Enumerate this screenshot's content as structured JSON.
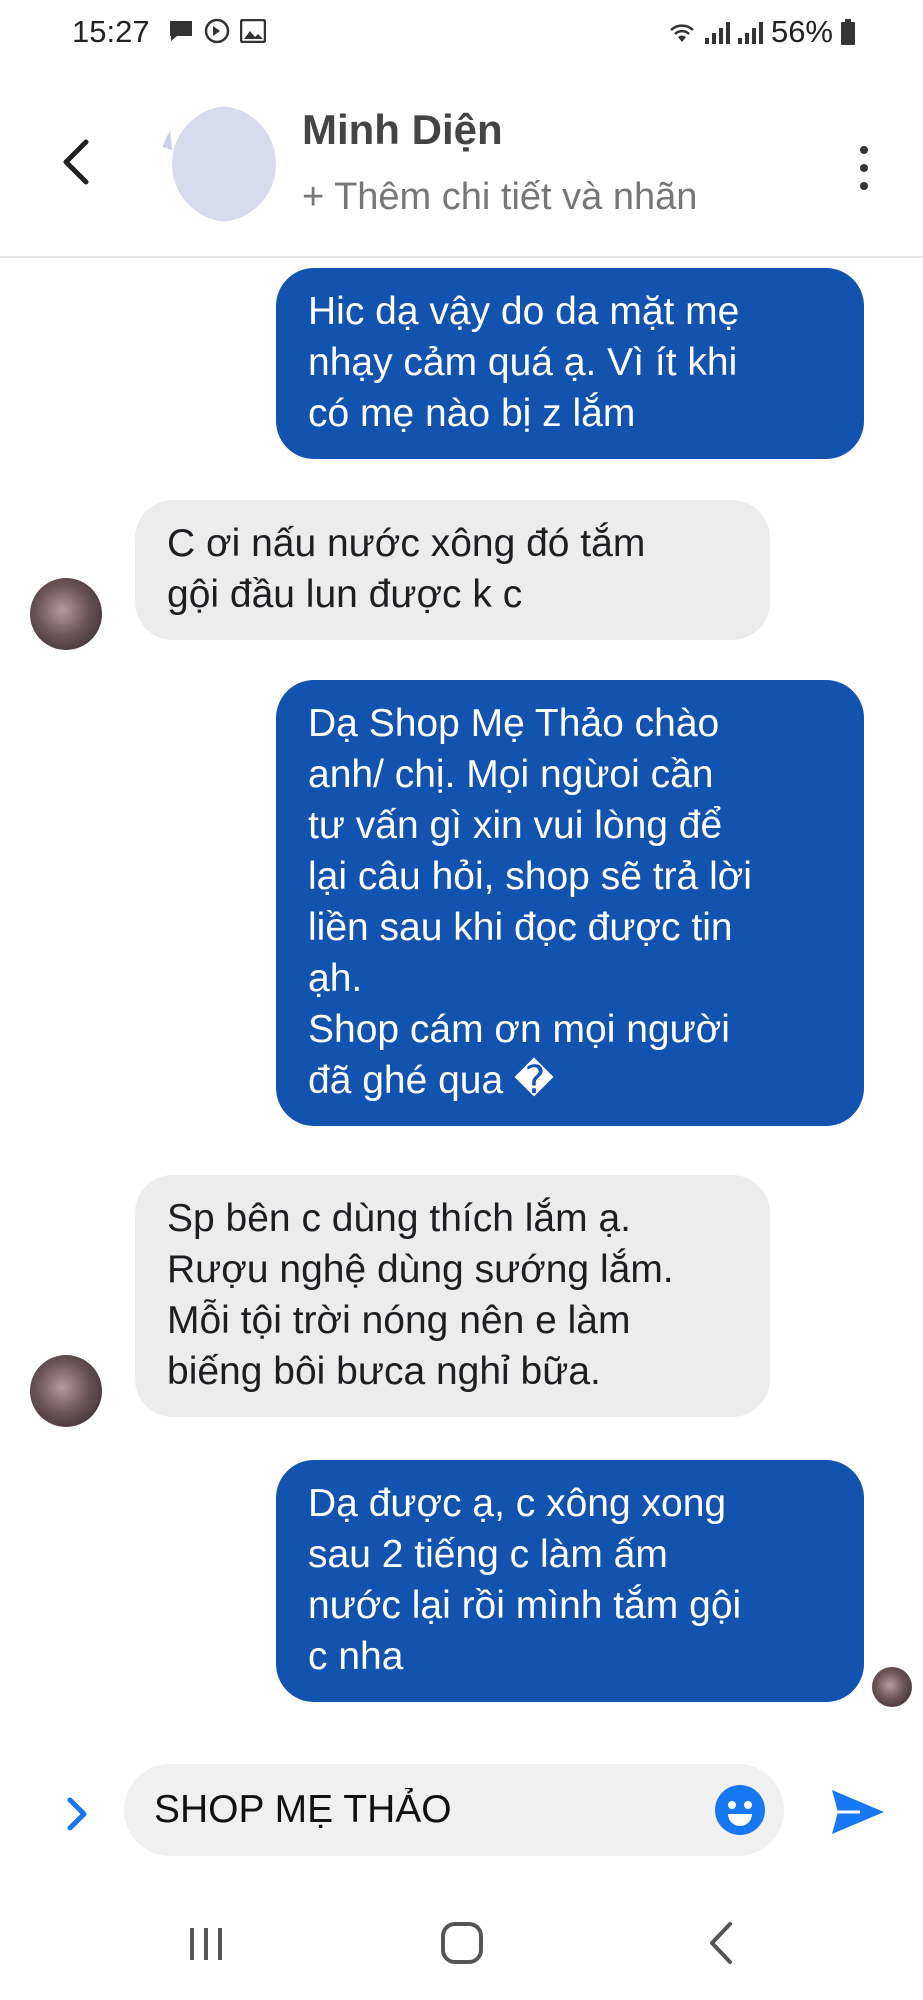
{
  "status_bar": {
    "time": "15:27",
    "battery": "56%"
  },
  "header": {
    "contact_name": "Minh Diện",
    "subtitle": "+ Thêm chi tiết và nhãn"
  },
  "messages": [
    {
      "direction": "outgoing",
      "text": "Hic dạ vậy do da mặt mẹ\nnhạy cảm quá ạ. Vì ít khi\ncó mẹ nào bị z lắm"
    },
    {
      "direction": "incoming",
      "text": "C ơi nấu nước xông đó tắm\ngội đầu lun được k c"
    },
    {
      "direction": "outgoing",
      "text": "Dạ Shop Mẹ Thảo chào\nanh/ chị. Mọi ngừoi cần\ntư vấn gì xin vui lòng để\nlại câu hỏi, shop sẽ trả lời\nliền sau khi đọc được tin\nạh.\nShop cám ơn mọi người\nđã ghé qua �"
    },
    {
      "direction": "incoming",
      "text": "Sp bên c dùng thích lắm ạ.\nRượu nghệ dùng sướng lắm.\nMỗi tội trời nóng nên e làm\nbiếng bôi bưca nghỉ bữa."
    },
    {
      "direction": "outgoing",
      "text": "Dạ được ạ, c xông xong\nsau 2 tiếng c làm ấm\nnước lại rồi mình tắm gội\nc nha"
    }
  ],
  "composer": {
    "input_value": "SHOP MẸ THẢO"
  },
  "icons": {
    "back": "chevron-left-icon",
    "menu": "more-vertical-icon",
    "expand": "chevron-right-icon",
    "emoji": "smiley-icon",
    "send": "send-icon"
  },
  "colors": {
    "outgoing_bubble": "#1353b0",
    "incoming_bubble": "#ececec",
    "accent": "#1877f2"
  }
}
